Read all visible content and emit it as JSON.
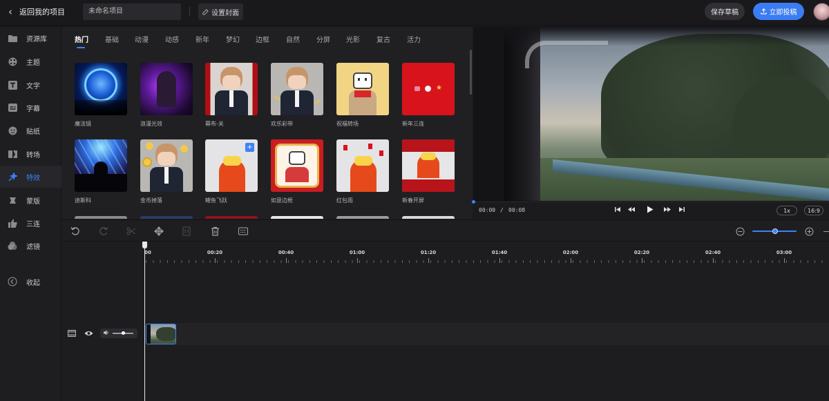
{
  "topbar": {
    "back_label": "返回我的项目",
    "project_name_value": "未命名项目",
    "set_cover_label": "设置封面",
    "save_draft_label": "保存草稿",
    "publish_label": "立即投稿"
  },
  "sidebar": {
    "items": [
      {
        "label": "资源库",
        "icon": "folder-icon"
      },
      {
        "label": "主题",
        "icon": "theme-icon"
      },
      {
        "label": "文字",
        "icon": "text-icon"
      },
      {
        "label": "字幕",
        "icon": "subtitle-icon"
      },
      {
        "label": "贴纸",
        "icon": "sticker-icon"
      },
      {
        "label": "转场",
        "icon": "transition-icon"
      },
      {
        "label": "特效",
        "icon": "effects-icon",
        "active": true
      },
      {
        "label": "蒙版",
        "icon": "mask-icon"
      },
      {
        "label": "三连",
        "icon": "thumbs-up-icon"
      },
      {
        "label": "滤镜",
        "icon": "filter-icon"
      },
      {
        "label": "收起",
        "icon": "collapse-icon"
      }
    ]
  },
  "effects": {
    "tabs": [
      "热门",
      "基础",
      "动漫",
      "动感",
      "新年",
      "梦幻",
      "边框",
      "自然",
      "分屏",
      "光影",
      "复古",
      "活力"
    ],
    "active_tab": "热门",
    "items": [
      {
        "label": "魔法镜"
      },
      {
        "label": "浪漫光效"
      },
      {
        "label": "幕布-关"
      },
      {
        "label": "欢乐彩带"
      },
      {
        "label": "祝福转场"
      },
      {
        "label": "新年三连"
      },
      {
        "label": "迪斯科"
      },
      {
        "label": "金币掉落"
      },
      {
        "label": "鲤鱼飞跃"
      },
      {
        "label": "如意边框"
      },
      {
        "label": "红包雨"
      },
      {
        "label": "新春开屏"
      }
    ]
  },
  "preview": {
    "current_time": "00:00",
    "separator": "/",
    "total_time": "00:08",
    "speed": "1x",
    "ratio": "16:9"
  },
  "timeline": {
    "ruler_labels": [
      "00",
      "00:20",
      "00:40",
      "01:00",
      "01:20",
      "01:40",
      "02:00",
      "02:20",
      "02:40",
      "03:00"
    ]
  },
  "colors": {
    "accent": "#3d82f6",
    "background": "#1c1c1f"
  }
}
